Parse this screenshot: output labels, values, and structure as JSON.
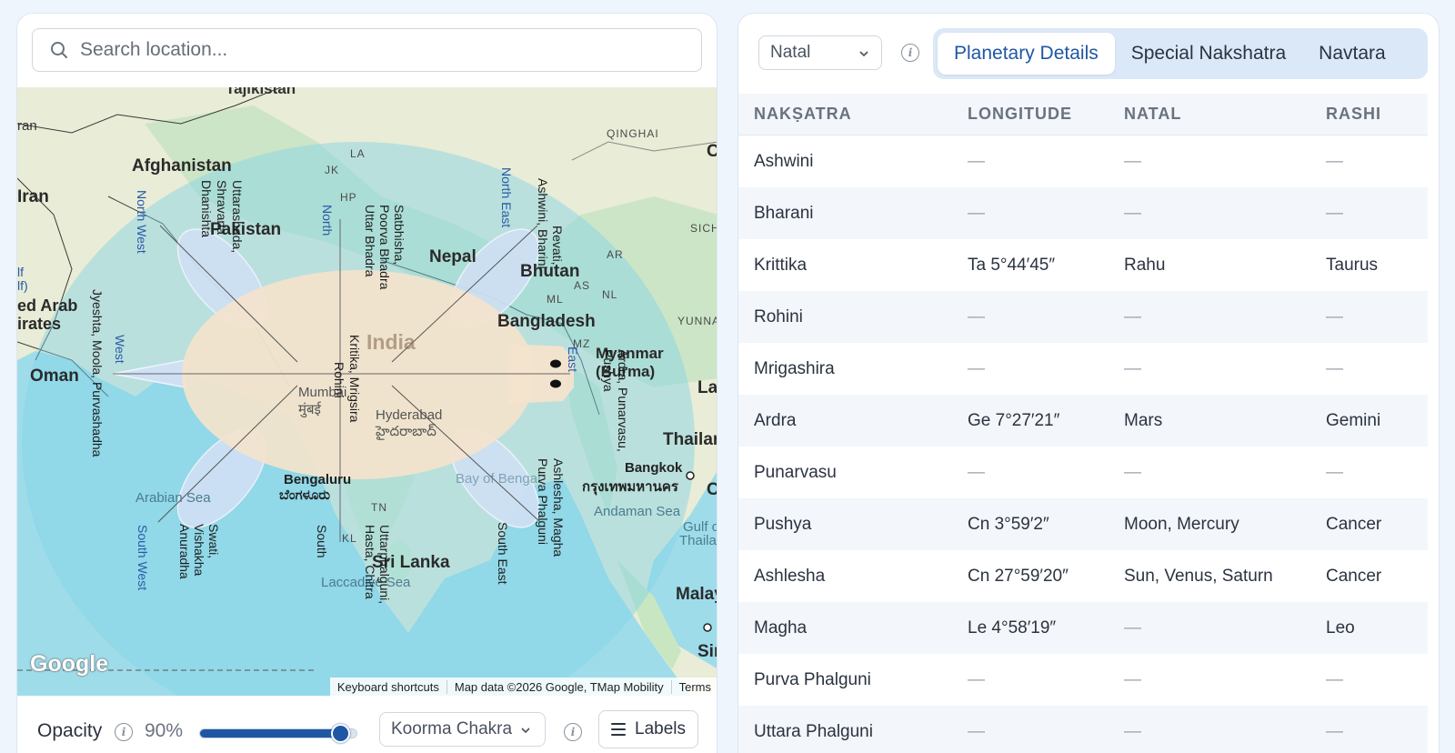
{
  "search": {
    "placeholder": "Search location..."
  },
  "map": {
    "countries": [
      "Tajikistan",
      "Afghanistan",
      "Iran",
      "Pakistan",
      "Nepal",
      "Bhutan",
      "Bangladesh",
      "India",
      "Myanmar (Burma)",
      "Oman",
      "Thailand",
      "Sri Lanka",
      "United Arab Emirates"
    ],
    "country_fragments": {
      "iran_top": "ran",
      "uae_line1": "ed Arab",
      "uae_line2": "irates",
      "gulf1": "lf",
      "gulf2": "lf)",
      "thailand": "Thailar",
      "lao": "La",
      "malay": "Malay",
      "sin": "Sir",
      "c_edge": "C",
      "c_edge2": "C"
    },
    "regions": [
      "QINGHAI",
      "SICH",
      "YUNNA",
      "JK",
      "LA",
      "HP",
      "AS",
      "ML",
      "NL",
      "MZ",
      "AR",
      "TN",
      "KL"
    ],
    "cities": {
      "mumbai": "Mumbai",
      "mumbai_local": "मुंबई",
      "hyderabad": "Hyderabad",
      "hyderabad_local": "హైదరాబాద్",
      "bengaluru": "Bengaluru",
      "bengaluru_local": "ಬೆಂಗಳೂರು",
      "bangkok": "Bangkok",
      "bangkok_local": "กรุงเทพมหานคร"
    },
    "seas": {
      "arabian": "Arabian Sea",
      "andaman": "Andaman Sea",
      "bengal": "Bay of Bengal",
      "laccadive": "Laccadive Sea",
      "gulf_th1": "Gulf o",
      "gulf_th2": "Thailan"
    },
    "nakshatra_labels": {
      "north_west_dir": "North West",
      "north_west_1": "Dhanishta",
      "north_west_2": "Shravana",
      "north_west_3": "Uttarashada,",
      "north_dir": "North",
      "north_1": "Uttar Bhadra",
      "north_2": "Poorva Bhadra",
      "north_3": "Satbhisha,",
      "north_east_dir": "North East",
      "north_east_1": "Ashwini, Bharini",
      "north_east_2": "Revati,",
      "west_dir": "West",
      "west_1": "Jyeshta, Moola, Purvashadha",
      "center_1": "Kritika, Mrigsira",
      "center_2": "Rohini",
      "east_dir": "East",
      "east_1": "Pushya",
      "east_2": "Ardra, Punarvasu,",
      "south_west_dir": "South West",
      "south_west_1": "Anuradha",
      "south_west_2": "Vishakha",
      "south_west_3": "Swati,",
      "south_dir": "South",
      "south_1": "Hasta, Chitra",
      "south_2": "Uttarphalguni,",
      "south_east_dir": "South East",
      "south_east_1": "Purva Phalguni",
      "south_east_2": "Ashlesha, Magha"
    },
    "google_logo": "Google",
    "attribution": [
      "Keyboard shortcuts",
      "Map data ©2026 Google, TMap Mobility",
      "Terms"
    ]
  },
  "controls": {
    "opacity_label": "Opacity",
    "opacity_value": "90%",
    "opacity_fraction": 0.9,
    "chakra_select": "Koorma Chakra",
    "labels_button": "Labels"
  },
  "right": {
    "mode_select": "Natal",
    "tabs": [
      {
        "label": "Planetary Details",
        "active": true
      },
      {
        "label": "Special Nakshatra",
        "active": false
      },
      {
        "label": "Navtara",
        "active": false
      }
    ],
    "columns": [
      "NAKṢATRA",
      "LONGITUDE",
      "NATAL",
      "RASHI"
    ],
    "rows": [
      {
        "nakshatra": "Ashwini",
        "longitude": "—",
        "natal": "—",
        "rashi": "—"
      },
      {
        "nakshatra": "Bharani",
        "longitude": "—",
        "natal": "—",
        "rashi": "—"
      },
      {
        "nakshatra": "Krittika",
        "longitude": "Ta 5°44′45″",
        "natal": "Rahu",
        "rashi": "Taurus"
      },
      {
        "nakshatra": "Rohini",
        "longitude": "—",
        "natal": "—",
        "rashi": "—"
      },
      {
        "nakshatra": "Mrigashira",
        "longitude": "—",
        "natal": "—",
        "rashi": "—"
      },
      {
        "nakshatra": "Ardra",
        "longitude": "Ge 7°27′21″",
        "natal": "Mars",
        "rashi": "Gemini"
      },
      {
        "nakshatra": "Punarvasu",
        "longitude": "—",
        "natal": "—",
        "rashi": "—"
      },
      {
        "nakshatra": "Pushya",
        "longitude": "Cn 3°59′2″",
        "natal": "Moon, Mercury",
        "rashi": "Cancer"
      },
      {
        "nakshatra": "Ashlesha",
        "longitude": "Cn 27°59′20″",
        "natal": "Sun, Venus, Saturn",
        "rashi": "Cancer"
      },
      {
        "nakshatra": "Magha",
        "longitude": "Le 4°58′19″",
        "natal": "—",
        "rashi": "Leo"
      },
      {
        "nakshatra": "Purva Phalguni",
        "longitude": "—",
        "natal": "—",
        "rashi": "—"
      },
      {
        "nakshatra": "Uttara Phalguni",
        "longitude": "—",
        "natal": "—",
        "rashi": "—"
      }
    ]
  },
  "colors": {
    "accent": "#1f57a4",
    "tab_bg": "#dbe8f8",
    "page_bg": "#eef5fd"
  }
}
